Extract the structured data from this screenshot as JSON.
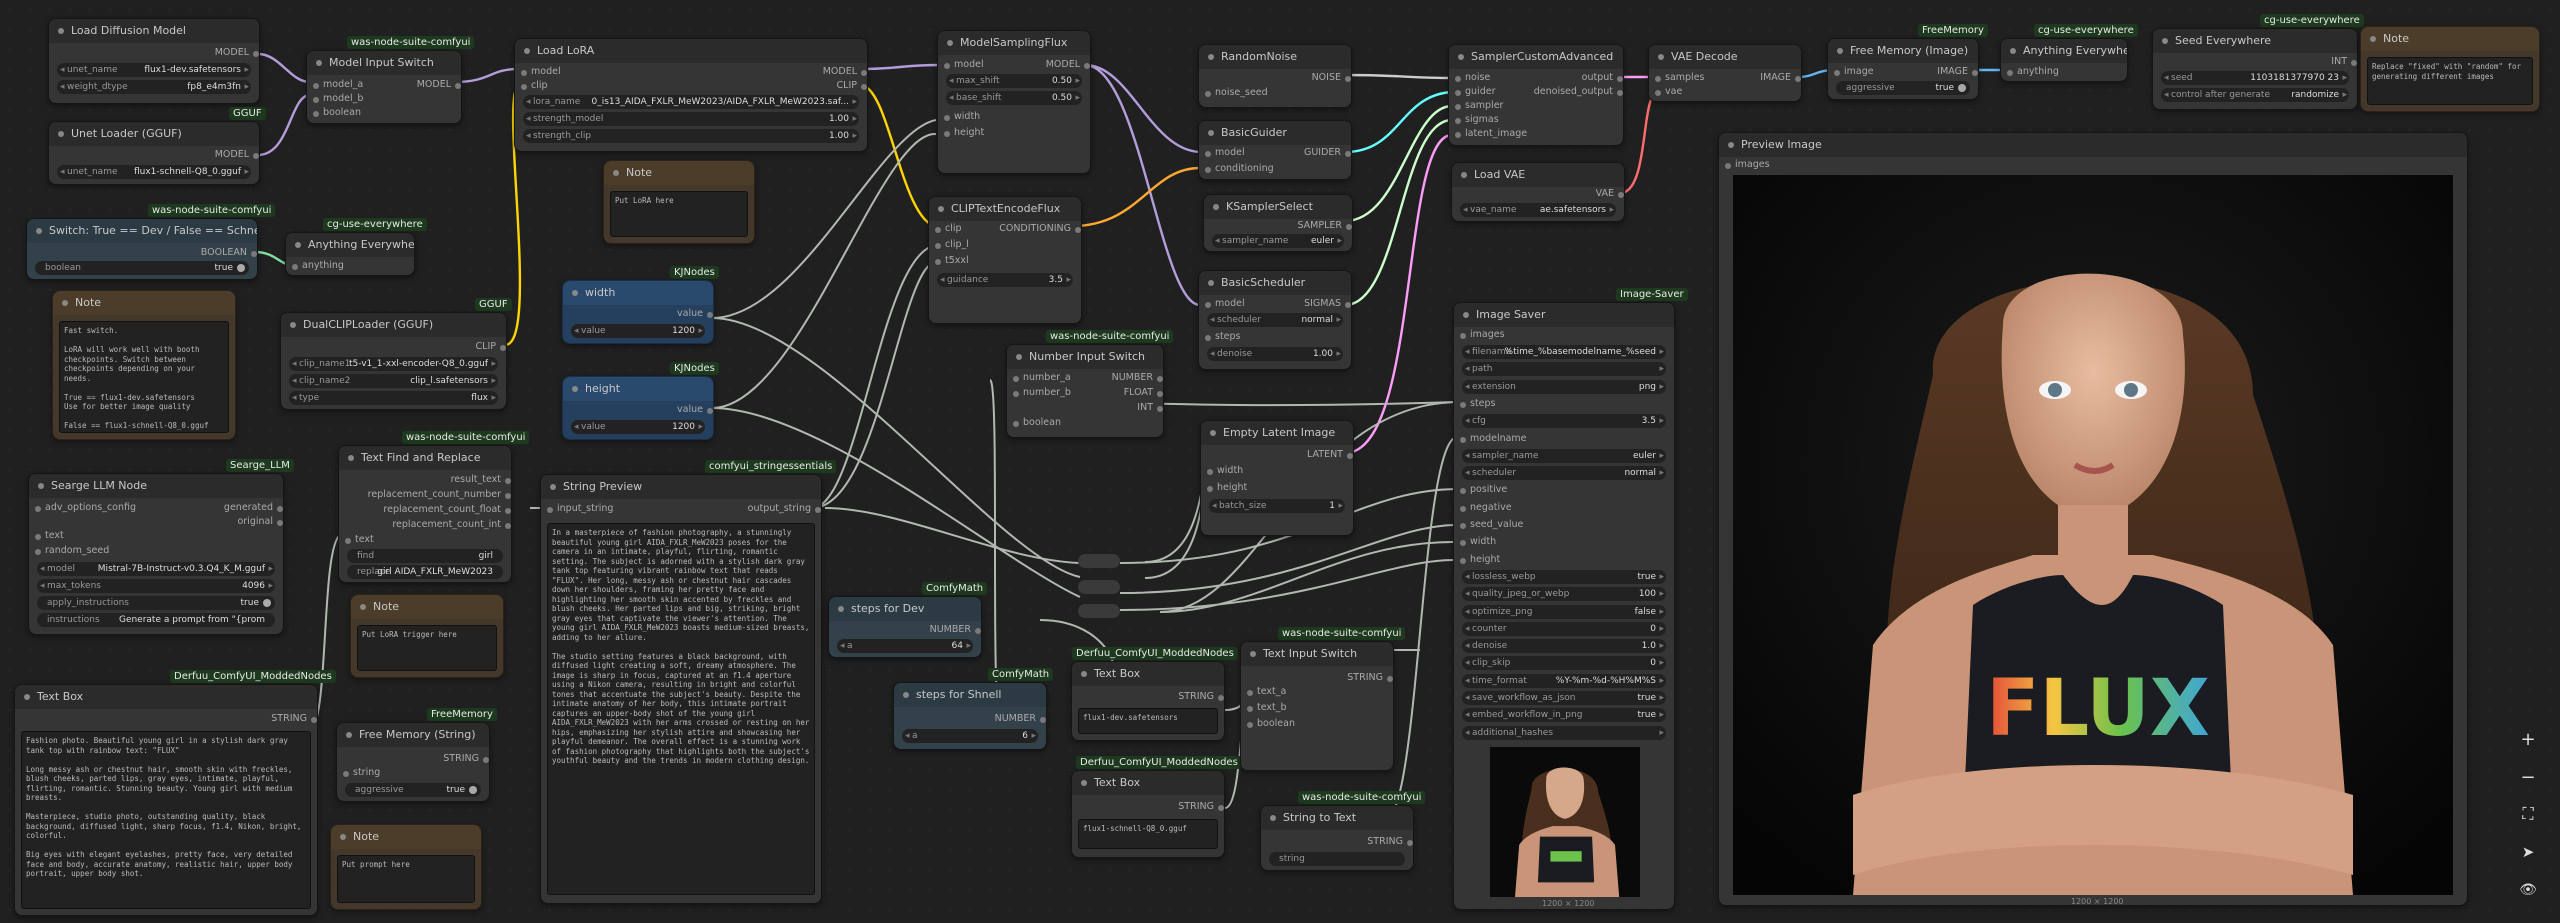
{
  "accent": {
    "model": "#b39ddb",
    "clip": "#ffd500",
    "conditioning": "#ffa931",
    "latent": "#ff9cf9",
    "int": "#7fdf9f",
    "image": "#64b5f6",
    "vae": "#ff6e6e",
    "string": "#7fcf7f",
    "guider": "#66ffff",
    "sigmas": "#cdffcd",
    "noise": "#b0b0b0"
  },
  "nodes": {
    "load_diffusion": {
      "title": "Load Diffusion Model",
      "out": "MODEL",
      "unet_name_label": "unet_name",
      "unet_name": "flux1-dev.safetensors",
      "weight_dtype_label": "weight_dtype",
      "weight_dtype": "fp8_e4m3fn"
    },
    "unet_gguf": {
      "title": "Unet Loader (GGUF)",
      "badge": "GGUF",
      "out": "MODEL",
      "unet_name_label": "unet_name",
      "unet_name": "flux1-schnell-Q8_0.gguf"
    },
    "switch_true": {
      "title": "Switch: True == Dev / False == Schnell",
      "badge": "was-node-suite-comfyui",
      "out": "BOOLEAN",
      "w_label": "boolean",
      "w_value": "true"
    },
    "anything_everywhere_1": {
      "title": "Anything Everywhere",
      "badge": "cg-use-everywhere",
      "in": "anything"
    },
    "note_switch": {
      "title": "Note",
      "text": "Fast switch.\n\nLoRA will work well with booth\ncheckpoints. Switch between\ncheckpoints depending on your needs.\n\nTrue == flux1-dev.safetensors\nUse for better image quality\n\nFalse == flux1-schnell-Q8_0.gguf\nUse for faster rendering"
    },
    "model_input_switch": {
      "title": "Model Input Switch",
      "badge": "was-node-suite-comfyui",
      "in1": "model_a",
      "in2": "model_b",
      "in3": "boolean",
      "out": "MODEL"
    },
    "dualclip": {
      "title": "DualCLIPLoader (GGUF)",
      "badge": "GGUF",
      "out": "CLIP",
      "w1_label": "clip_name1",
      "w1": "t5-v1_1-xxl-encoder-Q8_0.gguf",
      "w2_label": "clip_name2",
      "w2": "clip_l.safetensors",
      "w3_label": "type",
      "w3": "flux"
    },
    "load_lora": {
      "title": "Load LoRA",
      "in1": "model",
      "in2": "clip",
      "out1": "MODEL",
      "out2": "CLIP",
      "w1_label": "lora_name",
      "w1": "0_is13_AIDA_FXLR_MeW2023/AIDA_FXLR_MeW2023.saf...",
      "w2_label": "strength_model",
      "w2": "1.00",
      "w3_label": "strength_clip",
      "w3": "1.00"
    },
    "note_lora": {
      "title": "Note",
      "text": "Put LoRA here"
    },
    "kj_width": {
      "title": "width",
      "badge": "KJNodes",
      "out": "value",
      "w_label": "value",
      "w_value": "1200"
    },
    "kj_height": {
      "title": "height",
      "badge": "KJNodes",
      "out": "value",
      "w_label": "value",
      "w_value": "1200"
    },
    "model_sampling": {
      "title": "ModelSamplingFlux",
      "in1": "model",
      "in2": "width",
      "in3": "height",
      "out": "MODEL",
      "w1_label": "max_shift",
      "w1": "0.50",
      "w2_label": "base_shift",
      "w2": "0.50"
    },
    "clip_text_encode": {
      "title": "CLIPTextEncodeFlux",
      "in1": "clip",
      "in2": "clip_l",
      "in3": "t5xxl",
      "out": "CONDITIONING",
      "w_label": "guidance",
      "w_value": "3.5"
    },
    "random_noise": {
      "title": "RandomNoise",
      "out": "NOISE",
      "w_label": "noise_seed"
    },
    "basic_guider": {
      "title": "BasicGuider",
      "in1": "model",
      "in2": "conditioning",
      "out": "GUIDER"
    },
    "ksampler_select": {
      "title": "KSamplerSelect",
      "out": "SAMPLER",
      "w_label": "sampler_name",
      "w_value": "euler"
    },
    "basic_scheduler": {
      "title": "BasicScheduler",
      "in1": "model",
      "in2": "steps",
      "out": "SIGMAS",
      "w1_label": "scheduler",
      "w1": "normal",
      "w2_label": "denoise",
      "w2": "1.00"
    },
    "number_input_switch": {
      "title": "Number Input Switch",
      "badge": "was-node-suite-comfyui",
      "in1": "number_a",
      "in2": "number_b",
      "in3": "boolean",
      "out1": "NUMBER",
      "out2": "FLOAT",
      "out3": "INT"
    },
    "empty_latent": {
      "title": "Empty Latent Image",
      "in1": "width",
      "in2": "height",
      "out": "LATENT",
      "w_label": "batch_size",
      "w_value": "1"
    },
    "sampler_custom": {
      "title": "SamplerCustomAdvanced",
      "in1": "noise",
      "in2": "guider",
      "in3": "sampler",
      "in4": "sigmas",
      "in5": "latent_image",
      "out1": "output",
      "out2": "denoised_output"
    },
    "load_vae": {
      "title": "Load VAE",
      "out": "VAE",
      "w_label": "vae_name",
      "w_value": "ae.safetensors"
    },
    "vae_decode": {
      "title": "VAE Decode",
      "in1": "samples",
      "in2": "vae",
      "out": "IMAGE"
    },
    "free_memory_image": {
      "title": "Free Memory (Image)",
      "badge": "FreeMemory",
      "in": "image",
      "out": "IMAGE",
      "w_label": "aggressive",
      "w_value": "true"
    },
    "anything_everywhere_2": {
      "title": "Anything Everywhere",
      "badge": "cg-use-everywhere",
      "in": "anything"
    },
    "seed_everywhere": {
      "title": "Seed Everywhere",
      "badge": "cg-use-everywhere",
      "out": "INT",
      "w1_label": "seed",
      "w1": "1103181377970 23",
      "w2_label": "control after generate",
      "w2": "randomize"
    },
    "note_seed": {
      "title": "Note",
      "text": "Replace \"fixed\" with \"random\" for\ngenerating different images"
    },
    "preview": {
      "title": "Preview Image",
      "in": "images",
      "caption": "1200 × 1200"
    },
    "image_saver": {
      "title": "Image Saver",
      "badge": "Image-Saver",
      "in_images": "images",
      "rows": [
        {
          "k": "filename",
          "v": "%time_%basemodelname_%seed"
        },
        {
          "k": "path",
          "v": ""
        },
        {
          "k": "extension",
          "v": "png"
        },
        {
          "k": "steps",
          "v": "",
          "input": true
        },
        {
          "k": "cfg",
          "v": "3.5"
        },
        {
          "k": "modelname",
          "v": "",
          "input": true
        },
        {
          "k": "sampler_name",
          "v": "euler"
        },
        {
          "k": "scheduler",
          "v": "normal"
        },
        {
          "k": "positive",
          "v": "",
          "input": true
        },
        {
          "k": "negative",
          "v": "",
          "input": true
        },
        {
          "k": "seed_value",
          "v": "",
          "input": true
        },
        {
          "k": "width",
          "v": "",
          "input": true
        },
        {
          "k": "height",
          "v": "",
          "input": true
        },
        {
          "k": "lossless_webp",
          "v": "true"
        },
        {
          "k": "quality_jpeg_or_webp",
          "v": "100"
        },
        {
          "k": "optimize_png",
          "v": "false"
        },
        {
          "k": "counter",
          "v": "0"
        },
        {
          "k": "denoise",
          "v": "1.0"
        },
        {
          "k": "clip_skip",
          "v": "0"
        },
        {
          "k": "time_format",
          "v": "%Y-%m-%d-%H%M%S"
        },
        {
          "k": "save_workflow_as_json",
          "v": "true"
        },
        {
          "k": "embed_workflow_in_png",
          "v": "true"
        },
        {
          "k": "additional_hashes",
          "v": ""
        }
      ],
      "caption": "1200 × 1200"
    },
    "searge": {
      "title": "Searge LLM Node",
      "badge": "Searge_LLM",
      "in1": "adv_options_config",
      "in2": "text",
      "in3": "random_seed",
      "out1": "generated",
      "out2": "original",
      "w1_label": "model",
      "w1": "Mistral-7B-Instruct-v0.3.Q4_K_M.gguf",
      "w2_label": "max_tokens",
      "w2": "4096",
      "w3_label": "apply_instructions",
      "w3": "true",
      "w4_label": "instructions",
      "w4": "Generate a prompt from \"{prom"
    },
    "text_find_replace": {
      "title": "Text Find and Replace",
      "badge": "was-node-suite-comfyui",
      "in": "text",
      "out1": "result_text",
      "out2": "replacement_count_number",
      "out3": "replacement_count_float",
      "out4": "replacement_count_int",
      "w1_label": "find",
      "w1": "girl",
      "w2_label": "replace",
      "w2": "girl AIDA_FXLR_MeW2023"
    },
    "note_trigger": {
      "title": "Note",
      "text": "Put LoRA trigger here"
    },
    "string_preview": {
      "title": "String Preview",
      "badge": "comfyui_stringessentials",
      "in": "input_string",
      "out": "output_string",
      "text": "In a masterpiece of fashion photography, a stunningly beautiful young girl AIDA_FXLR_MeW2023 poses for the camera in an intimate, playful, flirting, romantic setting. The subject is adorned with a stylish dark gray tank top featuring vibrant rainbow text that reads \"FLUX\". Her long, messy ash or chestnut hair cascades down her shoulders, framing her pretty face and highlighting her smooth skin accented by freckles and blush cheeks. Her parted lips and big, striking, bright gray eyes that captivate the viewer's attention. The young girl AIDA_FXLR_MeW2023 boasts medium-sized breasts, adding to her allure.\n\nThe studio setting features a black background, with diffused light creating a soft, dreamy atmosphere. The image is sharp in focus, captured at an f1.4 aperture using a Nikon camera, resulting in bright and colorful tones that accentuate the subject's beauty. Despite the intimate anatomy of her body, this intimate portrait captures an upper-body shot of the young girl AIDA_FXLR_MeW2023 with her arms crossed or resting on her hips, emphasizing her stylish attire and showcasing her playful demeanor. The overall effect is a stunning work of fashion photography that highlights both the subject's youthful beauty and the trends in modern clothing design."
    },
    "steps_dev": {
      "title": "steps for Dev",
      "badge": "ComfyMath",
      "out": "NUMBER",
      "w_label": "a",
      "w_value": "64"
    },
    "steps_schnell": {
      "title": "steps for Shnell",
      "badge": "ComfyMath",
      "out": "NUMBER",
      "w_label": "a",
      "w_value": "6"
    },
    "text_box_main": {
      "title": "Text Box",
      "badge": "Derfuu_ComfyUI_ModdedNodes",
      "out": "STRING",
      "text": "Fashion photo. Beautiful young girl in a stylish dark gray tank top with rainbow text: \"FLUX\"\n\nLong messy ash or chestnut hair, smooth skin with freckles, blush cheeks, parted lips, gray eyes, intimate, playful, flirting, romantic. Stunning beauty. Young girl with medium breasts.\n\nMasterpiece, studio photo, outstanding quality, black background, diffused light, sharp focus, f1.4, Nikon, bright, colorful.\n\nBig eyes with elegant eyelashes, pretty face, very detailed face and body, accurate anatomy, realistic hair, upper body portrait, upper body shot."
    },
    "free_memory_string": {
      "title": "Free Memory (String)",
      "badge": "FreeMemory",
      "in": "string",
      "out": "STRING",
      "w_label": "aggressive",
      "w_value": "true"
    },
    "note_prompt": {
      "title": "Note",
      "text": "Put prompt here"
    },
    "text_box_dev": {
      "title": "Text Box",
      "badge": "Derfuu_ComfyUI_ModdedNodes",
      "out": "STRING",
      "text": "flux1-dev.safetensors"
    },
    "text_box_schnell": {
      "title": "Text Box",
      "badge": "Derfuu_ComfyUI_ModdedNodes",
      "out": "STRING",
      "text": "flux1-schnell-Q8_0.gguf"
    },
    "text_input_switch": {
      "title": "Text Input Switch",
      "badge": "was-node-suite-comfyui",
      "in1": "text_a",
      "in2": "text_b",
      "in3": "boolean",
      "out": "STRING"
    },
    "string_to_text": {
      "title": "String to Text",
      "badge": "was-node-suite-comfyui",
      "out": "STRING",
      "w_label": "string"
    }
  },
  "toolbar": {
    "zoom_in": "+",
    "zoom_out": "−",
    "fit": "⛶",
    "arrow": "➤",
    "eye": "👁"
  },
  "preview_shirt_text": "FLUX"
}
